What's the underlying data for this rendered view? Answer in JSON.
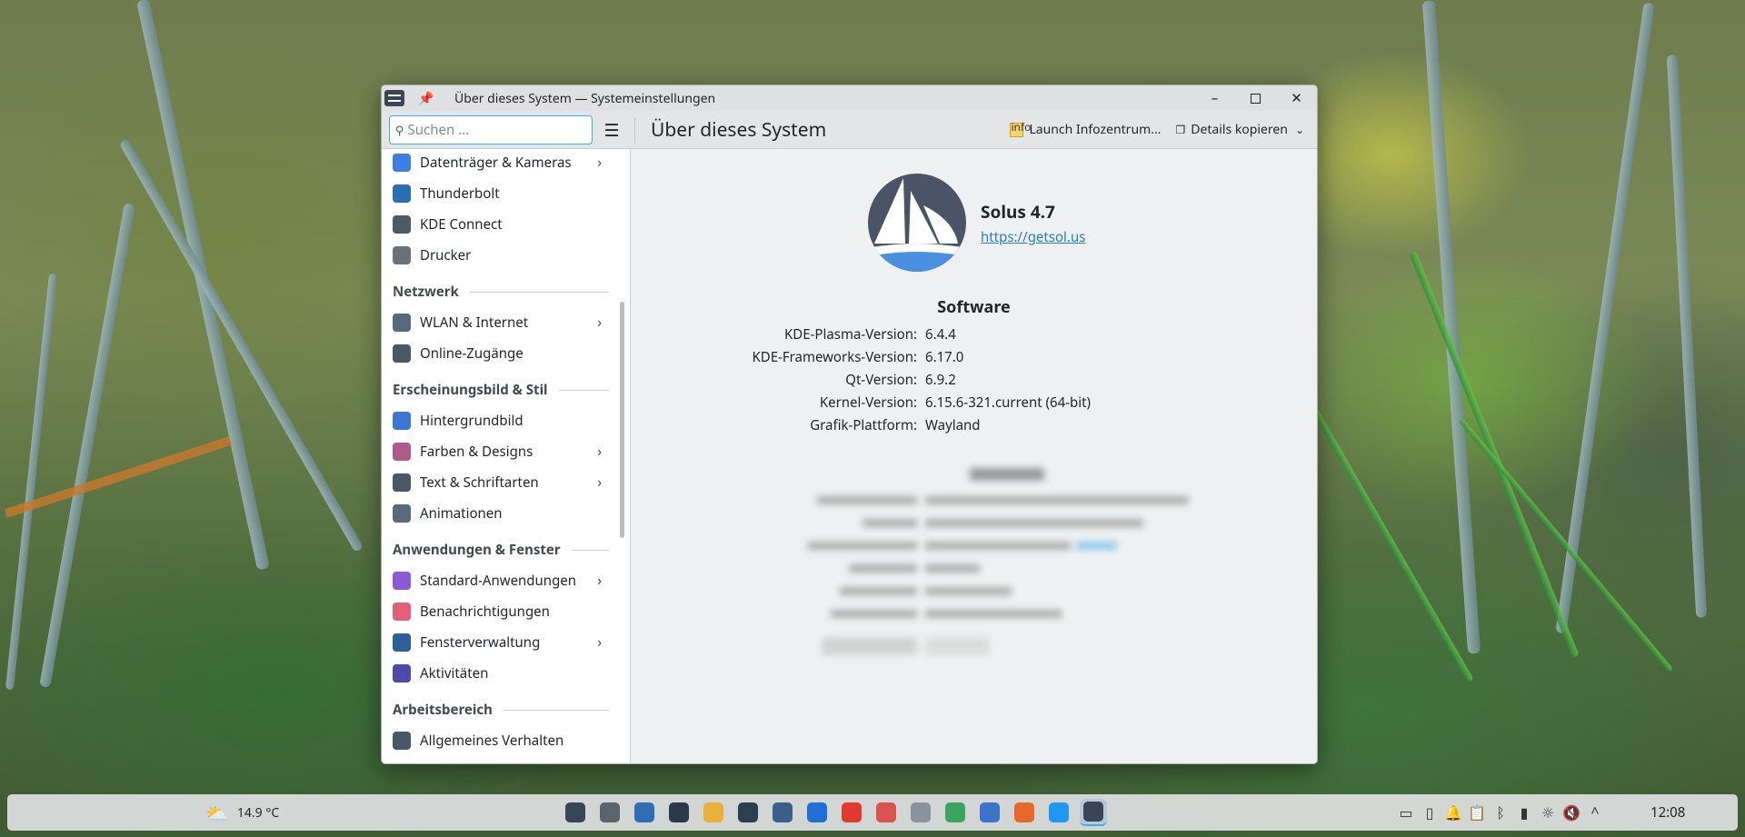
{
  "window": {
    "title": "Über dieses System — Systemeinstellungen"
  },
  "toolbar": {
    "search_placeholder": "Suchen ...",
    "page_title": "Über dieses System",
    "launch_label": "Launch Infozentrum...",
    "copy_label": "Details kopieren"
  },
  "sidebar": {
    "items_top": [
      {
        "label": "Datenträger & Kameras",
        "icon": "drive-camera-icon",
        "color": "#3d7ee0",
        "chevron": true
      },
      {
        "label": "Thunderbolt",
        "icon": "thunderbolt-icon",
        "color": "#2a6fb0",
        "chevron": false
      },
      {
        "label": "KDE Connect",
        "icon": "kde-connect-icon",
        "color": "#4d5a66",
        "chevron": false
      },
      {
        "label": "Drucker",
        "icon": "printer-icon",
        "color": "#6b7178",
        "chevron": false
      }
    ],
    "sections": [
      {
        "heading": "Netzwerk",
        "items": [
          {
            "label": "WLAN & Internet",
            "icon": "network-icon",
            "color": "#566a7a",
            "chevron": true
          },
          {
            "label": "Online-Zugänge",
            "icon": "online-accounts-icon",
            "color": "#4a5866",
            "chevron": false
          }
        ]
      },
      {
        "heading": "Erscheinungsbild & Stil",
        "items": [
          {
            "label": "Hintergrundbild",
            "icon": "wallpaper-icon",
            "color": "#3a78d4",
            "chevron": false
          },
          {
            "label": "Farben & Designs",
            "icon": "colors-icon",
            "color": "#b05a8a",
            "chevron": true
          },
          {
            "label": "Text & Schriftarten",
            "icon": "fonts-icon",
            "color": "#4a5866",
            "chevron": true
          },
          {
            "label": "Animationen",
            "icon": "animations-icon",
            "color": "#5a6a7a",
            "chevron": false
          }
        ]
      },
      {
        "heading": "Anwendungen & Fenster",
        "items": [
          {
            "label": "Standard-Anwendungen",
            "icon": "default-apps-icon",
            "color": "#8a5ad8",
            "chevron": true
          },
          {
            "label": "Benachrichtigungen",
            "icon": "notifications-icon",
            "color": "#e0607a",
            "chevron": false
          },
          {
            "label": "Fensterverwaltung",
            "icon": "window-management-icon",
            "color": "#2f5f9a",
            "chevron": true
          },
          {
            "label": "Aktivitäten",
            "icon": "activities-icon",
            "color": "#4f4aa8",
            "chevron": false
          }
        ]
      },
      {
        "heading": "Arbeitsbereich",
        "items": [
          {
            "label": "Allgemeines Verhalten",
            "icon": "general-behavior-icon",
            "color": "#4a5866",
            "chevron": false
          }
        ]
      }
    ]
  },
  "about": {
    "distro_name": "Solus 4.7",
    "distro_url": "https://getsol.us",
    "software_heading": "Software",
    "software": [
      {
        "key": "KDE-Plasma-Version:",
        "value": "6.4.4"
      },
      {
        "key": "KDE-Frameworks-Version:",
        "value": "6.17.0"
      },
      {
        "key": "Qt-Version:",
        "value": "6.9.2"
      },
      {
        "key": "Kernel-Version:",
        "value": "6.15.6-321.current (64-bit)"
      },
      {
        "key": "Grafik-Plattform:",
        "value": "Wayland"
      }
    ]
  },
  "taskbar": {
    "weather": "14.9 °C",
    "clock": "12:08",
    "apps": [
      {
        "name": "solus-menu-icon",
        "color": "#3a4556"
      },
      {
        "name": "search-icon",
        "color": "#5c636a"
      },
      {
        "name": "system-monitor-icon",
        "color": "#2f6db5"
      },
      {
        "name": "terminal-icon",
        "color": "#2b3a4a"
      },
      {
        "name": "files-icon",
        "color": "#e8b13a"
      },
      {
        "name": "discover-icon",
        "color": "#2c3e50"
      },
      {
        "name": "car-icon",
        "color": "#3a5f8a"
      },
      {
        "name": "uget-icon",
        "color": "#1f6fd6"
      },
      {
        "name": "pdf-icon",
        "color": "#e03a2f"
      },
      {
        "name": "pdf-arranger-icon",
        "color": "#d9534f"
      },
      {
        "name": "copy-icon",
        "color": "#8a939b"
      },
      {
        "name": "stacks-icon",
        "color": "#3aa55d"
      },
      {
        "name": "mail-icon",
        "color": "#3d73c9"
      },
      {
        "name": "firefox-icon",
        "color": "#e8672a"
      },
      {
        "name": "kde-icon",
        "color": "#1d99f3"
      },
      {
        "name": "settings-icon",
        "color": "#3a4556"
      }
    ],
    "tray": [
      "screen-icon",
      "storage-icon",
      "notification-bell-icon",
      "clipboard-icon",
      "bluetooth-icon",
      "battery-icon",
      "brightness-icon",
      "mute-icon",
      "show-hidden-icon"
    ]
  }
}
